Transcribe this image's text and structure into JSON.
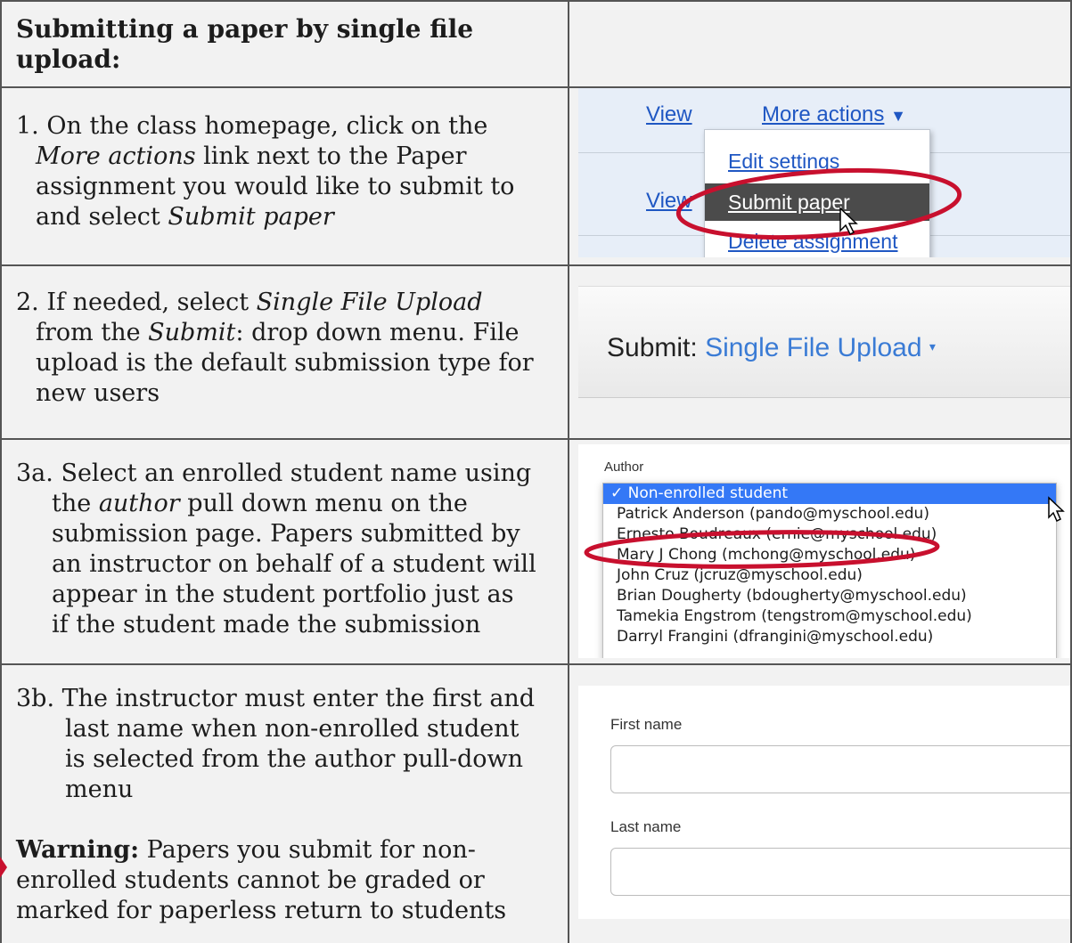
{
  "header": {
    "title": "Submitting a paper by single file upload:"
  },
  "steps": [
    {
      "n": "1.",
      "t1": "On the class homepage, click on the",
      "t2_em": "More actions",
      "t2_rest": " link next to the Paper",
      "t3": "assignment you would like to submit to",
      "t4_pre": "and select ",
      "t4_em": "Submit paper"
    },
    {
      "n": "2.",
      "t1_pre": "If needed, select ",
      "t1_em": "Single File Upload",
      "t2_pre": "from the ",
      "t2_em": "Submit",
      "t2_rest": ": drop down menu. File",
      "t3": "upload is the default submission type for",
      "t4": "new users"
    },
    {
      "n": "3a.",
      "t1": "Select an enrolled student name using",
      "t2_pre": "the ",
      "t2_em": "author",
      "t2_rest": " pull down menu on the",
      "t3": "submission page. Papers submitted by",
      "t4": "an instructor on behalf of a student will",
      "t5": "appear in the student portfolio just as",
      "t6": "if the student made the submission"
    },
    {
      "n": "3b.",
      "t1": "The instructor must enter the first and",
      "t2": "last name when non-enrolled student",
      "t3": "is selected from the author pull-down",
      "t4": "menu",
      "warn_label": "Warning:",
      "w1": " Papers you submit for non-",
      "w2": "enrolled students cannot be graded or",
      "w3": "marked for paperless return to students"
    }
  ],
  "shot1": {
    "view1": "View",
    "more": "More actions",
    "edit": "Edit settings",
    "view2": "View",
    "submit": "Submit paper",
    "delete": "Delete assignment"
  },
  "shot2": {
    "label": "Submit:",
    "value": "Single File Upload"
  },
  "shot3": {
    "label": "Author",
    "options": [
      "✓ Non-enrolled student",
      "Patrick Anderson (pando@myschool.edu)",
      "Ernesto Boudreaux (ernie@myschool.edu)",
      "Mary J Chong (mchong@myschool.edu)",
      "John Cruz (jcruz@myschool.edu)",
      "Brian Dougherty (bdougherty@myschool.edu)",
      "Tamekia Engstrom (tengstrom@myschool.edu)",
      "Darryl Frangini (dfrangini@myschool.edu)"
    ]
  },
  "shot4": {
    "first": "First name",
    "last": "Last name"
  },
  "colors": {
    "border": "#555555",
    "link": "#1f57c3",
    "highlight_ring": "#c8102e",
    "menu_selected": "#3478f6"
  }
}
